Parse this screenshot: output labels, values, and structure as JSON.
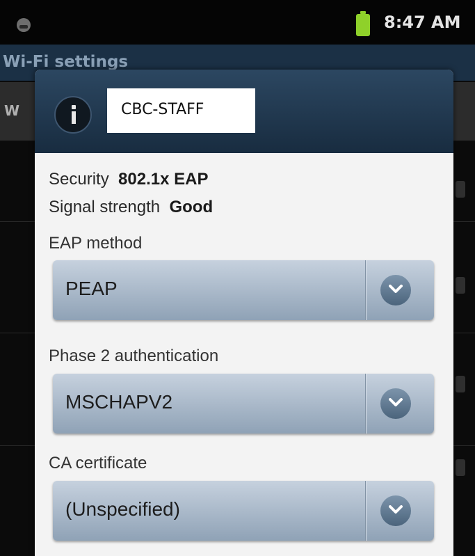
{
  "status_bar": {
    "time": "8:47 AM"
  },
  "app": {
    "title": "Wi-Fi settings",
    "header_letter": "W"
  },
  "dialog": {
    "network_name": "CBC-STAFF",
    "security_label": "Security",
    "security_value": "802.1x EAP",
    "signal_label": "Signal strength",
    "signal_value": "Good",
    "eap_method": {
      "label": "EAP method",
      "value": "PEAP"
    },
    "phase2": {
      "label": "Phase 2 authentication",
      "value": "MSCHAPV2"
    },
    "ca_cert": {
      "label": "CA certificate",
      "value": "(Unspecified)"
    }
  },
  "colors": {
    "battery": "#8fd12a",
    "dialog_header": "#203850",
    "select": "#a9b8c8"
  }
}
